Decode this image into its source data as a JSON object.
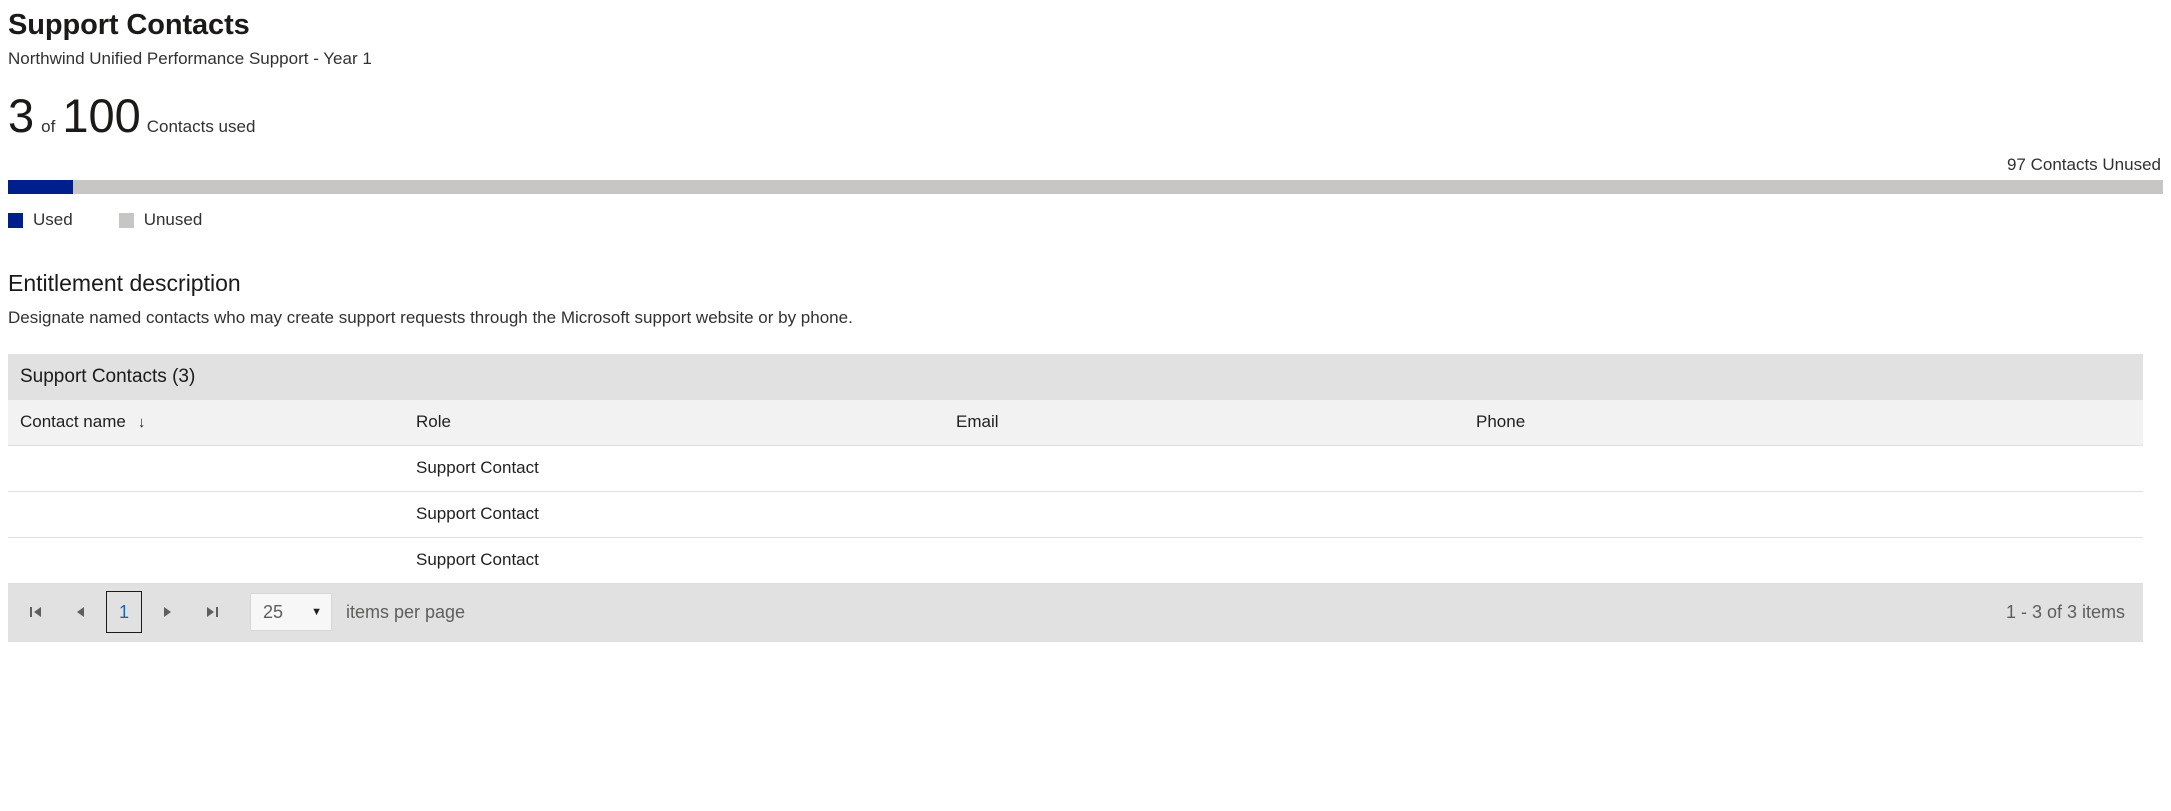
{
  "header": {
    "title": "Support Contacts",
    "subtitle": "Northwind Unified Performance Support - Year 1"
  },
  "usage": {
    "used": "3",
    "of": "of",
    "total": "100",
    "label": "Contacts used",
    "unused_caption": "97 Contacts Unused",
    "used_percent": 3,
    "used_color": "#001e8c",
    "unused_color": "#c8c6c4",
    "legend": [
      {
        "label": "Used",
        "color": "#001e8c",
        "swatch": "legend-swatch-used"
      },
      {
        "label": "Unused",
        "color": "#c8c6c4",
        "swatch": "legend-swatch-unused"
      }
    ]
  },
  "entitlement": {
    "title": "Entitlement description",
    "body": "Designate named contacts who may create support requests through the Microsoft support website or by phone."
  },
  "grid": {
    "title": "Support Contacts (3)",
    "columns": [
      {
        "label": "Contact name",
        "sort_icon": "arrow-down-icon",
        "sorted": true
      },
      {
        "label": "Role",
        "sorted": false
      },
      {
        "label": "Email",
        "sorted": false
      },
      {
        "label": "Phone",
        "sorted": false
      }
    ],
    "rows": [
      {
        "name": "",
        "role": "Support Contact",
        "email": "",
        "phone": ""
      },
      {
        "name": "",
        "role": "Support Contact",
        "email": "",
        "phone": ""
      },
      {
        "name": "",
        "role": "Support Contact",
        "email": "",
        "phone": ""
      }
    ]
  },
  "pager": {
    "first_icon": "first-page-icon",
    "prev_icon": "previous-page-icon",
    "current_page": "1",
    "next_icon": "next-page-icon",
    "last_icon": "last-page-icon",
    "page_size": "25",
    "page_size_caret": "caret-down-icon",
    "items_per_page_label": "items per page",
    "range_label": "1 - 3 of 3 items"
  }
}
